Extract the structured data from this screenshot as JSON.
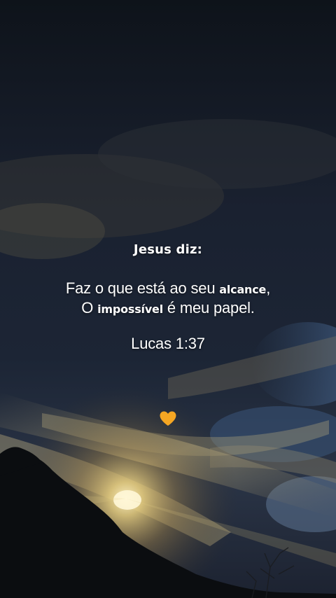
{
  "quote": {
    "heading": "Jesus diz:",
    "line1_part1": "Faz o que está ao seu ",
    "line1_emph": "alcance",
    "line1_part2": ",",
    "line2_part1": "O ",
    "line2_emph": "impossível",
    "line2_part2": " é meu papel.",
    "reference": "Lucas 1:37"
  },
  "decoration": {
    "heart_icon": "orange-heart-icon",
    "heart_color": "#f5a623"
  },
  "colors": {
    "sky_top": "#0f141c",
    "sky_mid": "#1a2230",
    "cloud_highlight": "#c9b98a",
    "sun_glow": "#f3e2a3",
    "text": "#ffffff"
  }
}
